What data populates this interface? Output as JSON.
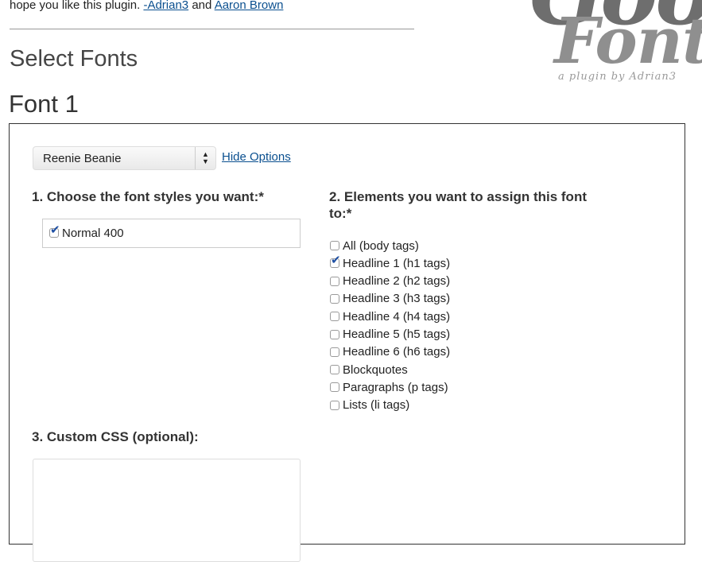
{
  "intro": {
    "text": "hope you like this plugin. ",
    "link1": "-Adrian3",
    "and": " and ",
    "link2": "Aaron Brown"
  },
  "logo": {
    "word_top": "Google",
    "word_main": "Fonts",
    "byline": "a plugin by Adrian3"
  },
  "page": {
    "section_title": "Select Fonts",
    "font_title": "Font 1"
  },
  "font_panel": {
    "selected_font": "Reenie Beanie",
    "hide_options_label": "Hide Options",
    "styles_label": "1. Choose the font styles you want:*",
    "styles": [
      {
        "label": "Normal 400",
        "checked": true
      }
    ],
    "elements_label": "2. Elements you want to assign this font to:*",
    "elements": [
      {
        "label": "All (body tags)",
        "checked": false
      },
      {
        "label": "Headline 1 (h1 tags)",
        "checked": true
      },
      {
        "label": "Headline 2 (h2 tags)",
        "checked": false
      },
      {
        "label": "Headline 3 (h3 tags)",
        "checked": false
      },
      {
        "label": "Headline 4 (h4 tags)",
        "checked": false
      },
      {
        "label": "Headline 5 (h5 tags)",
        "checked": false
      },
      {
        "label": "Headline 6 (h6 tags)",
        "checked": false
      },
      {
        "label": "Blockquotes",
        "checked": false
      },
      {
        "label": "Paragraphs (p tags)",
        "checked": false
      },
      {
        "label": "Lists (li tags)",
        "checked": false
      }
    ],
    "custom_css_label": "3. Custom CSS (optional):",
    "custom_css_value": ""
  },
  "colors": {
    "link": "#0a4f8f",
    "check": "#1e4fa3"
  }
}
